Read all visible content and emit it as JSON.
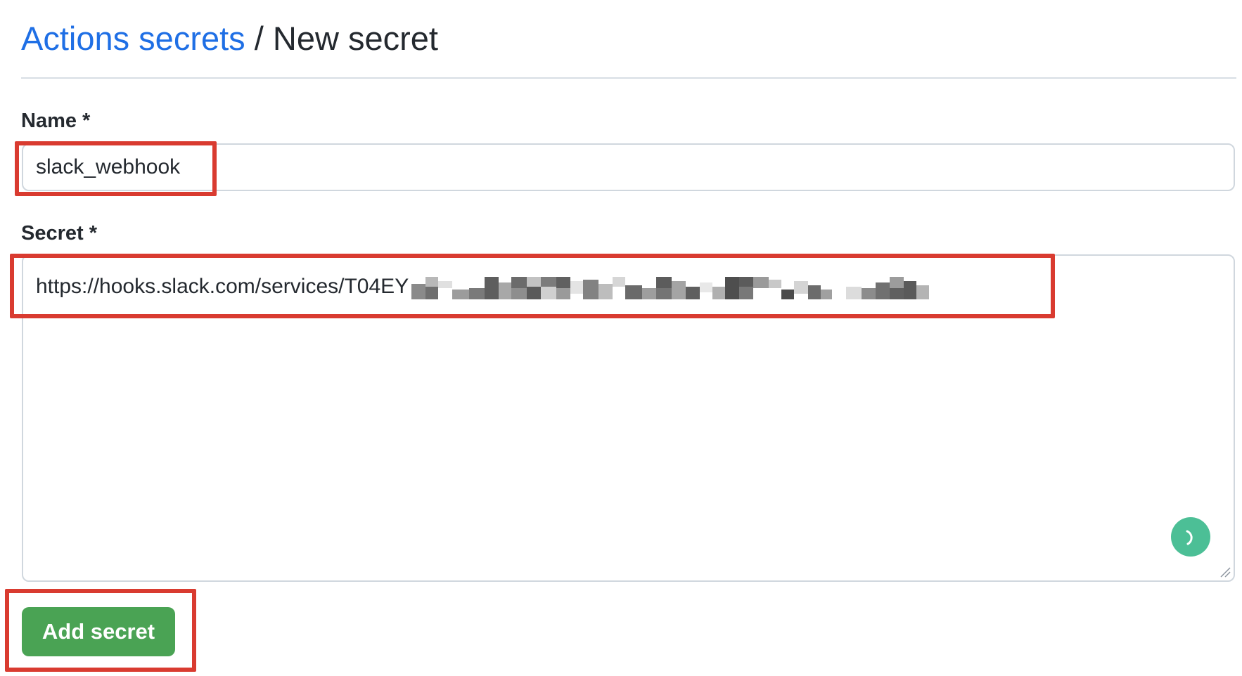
{
  "header": {
    "breadcrumb_link": "Actions secrets",
    "separator": "/",
    "current": "New secret"
  },
  "form": {
    "name_label": "Name *",
    "name_value": "slack_webhook",
    "secret_label": "Secret *",
    "secret_value_visible": "https://hooks.slack.com/services/T04EY",
    "secret_redacted": true,
    "submit_label": "Add secret"
  },
  "colors": {
    "link": "#1f6fe5",
    "button": "#4aa354",
    "highlight": "#d93b30",
    "assist_icon": "#4cbf96"
  },
  "icons": {
    "assist": "loading-spinner-icon",
    "resize": "resize-handle-icon"
  }
}
